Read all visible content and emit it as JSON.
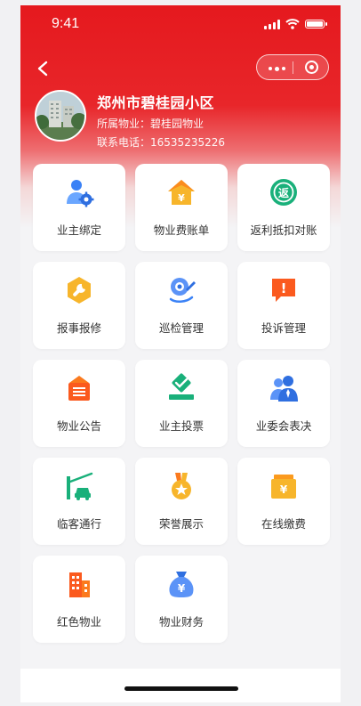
{
  "status_bar": {
    "time": "9:41"
  },
  "header": {
    "community_name": "郑州市碧桂园小区",
    "property_label": "所属物业：",
    "property_value": "碧桂园物业",
    "phone_label": "联系电话：",
    "phone_value": "16535235226"
  },
  "colors": {
    "brand_red": "#e5191e",
    "blue": "#3b82f6",
    "orange": "#fb7a1e",
    "yellow": "#f7b52b",
    "green": "#19b07a"
  },
  "menu": [
    {
      "label": "业主绑定",
      "icon": "owner-bind-icon"
    },
    {
      "label": "物业费账单",
      "icon": "property-fee-bill-icon"
    },
    {
      "label": "返利抵扣对账",
      "icon": "rebate-reconcile-icon",
      "glyph": "返"
    },
    {
      "label": "报事报修",
      "icon": "repair-wrench-icon"
    },
    {
      "label": "巡检管理",
      "icon": "inspection-icon"
    },
    {
      "label": "投诉管理",
      "icon": "complaint-icon",
      "glyph": "!"
    },
    {
      "label": "物业公告",
      "icon": "announcement-icon"
    },
    {
      "label": "业主投票",
      "icon": "vote-icon"
    },
    {
      "label": "业委会表决",
      "icon": "committee-icon"
    },
    {
      "label": "临客通行",
      "icon": "visitor-gate-icon"
    },
    {
      "label": "荣誉展示",
      "icon": "honor-medal-icon"
    },
    {
      "label": "在线缴费",
      "icon": "online-payment-icon",
      "glyph": "¥"
    },
    {
      "label": "红色物业",
      "icon": "red-building-icon"
    },
    {
      "label": "物业财务",
      "icon": "finance-bag-icon",
      "glyph": "¥"
    }
  ]
}
